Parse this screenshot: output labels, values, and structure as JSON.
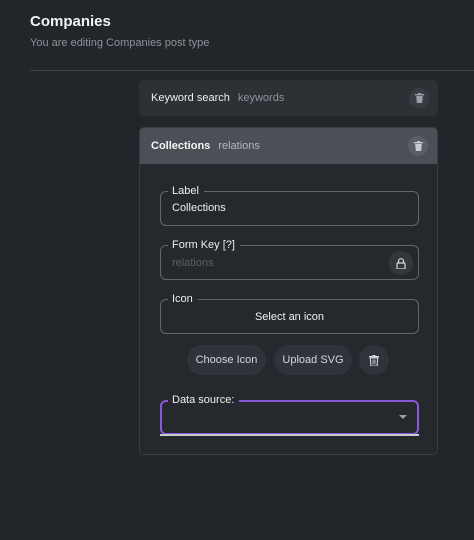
{
  "header": {
    "title": "Companies",
    "subtitle": "You are editing Companies post type"
  },
  "fields": [
    {
      "name": "Keyword search",
      "type": "keywords",
      "expanded": false
    },
    {
      "name": "Collections",
      "type": "relations",
      "expanded": true
    }
  ],
  "editor": {
    "label_legend": "Label",
    "label_value": "Collections",
    "form_key_legend": "Form Key [?]",
    "form_key_placeholder": "relations",
    "icon_legend": "Icon",
    "icon_select_text": "Select an icon",
    "choose_icon_label": "Choose Icon",
    "upload_svg_label": "Upload SVG",
    "data_source_legend": "Data source:",
    "data_source_value": ""
  },
  "icons": {
    "delete": "trash-icon",
    "lock": "lock-icon",
    "dropdown": "caret-down-icon"
  },
  "colors": {
    "background": "#22252a",
    "focus_accent": "#8a57d6",
    "header_bar": "#4c5056"
  }
}
